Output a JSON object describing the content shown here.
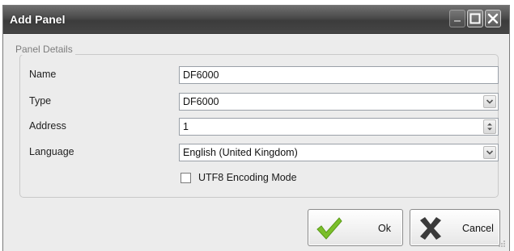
{
  "window": {
    "title": "Add Panel"
  },
  "title_bar_buttons": [
    "minimize",
    "maximize",
    "close"
  ],
  "group": {
    "legend": "Panel Details"
  },
  "form": {
    "name": {
      "label": "Name",
      "value": "DF6000"
    },
    "type": {
      "label": "Type",
      "value": "DF6000"
    },
    "address": {
      "label": "Address",
      "value": "1"
    },
    "language": {
      "label": "Language",
      "value": "English (United Kingdom)"
    },
    "utf8": {
      "label": "UTF8 Encoding Mode",
      "checked": false
    }
  },
  "buttons": {
    "ok": {
      "label": "Ok",
      "icon": "checkmark-icon",
      "icon_color": "#7bbf2a"
    },
    "cancel": {
      "label": "Cancel",
      "icon": "x-icon",
      "icon_color": "#3a3a3a"
    }
  },
  "colors": {
    "title_bar": "#4a4a4a",
    "window_bg": "#ececec"
  }
}
